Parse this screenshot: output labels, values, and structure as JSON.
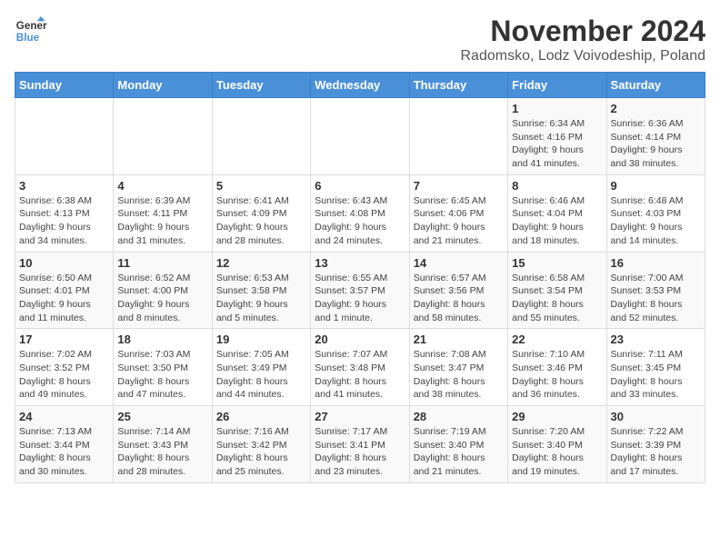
{
  "logo": {
    "line1": "General",
    "line2": "Blue"
  },
  "title": "November 2024",
  "subtitle": "Radomsko, Lodz Voivodeship, Poland",
  "weekdays": [
    "Sunday",
    "Monday",
    "Tuesday",
    "Wednesday",
    "Thursday",
    "Friday",
    "Saturday"
  ],
  "weeks": [
    [
      {
        "day": "",
        "info": ""
      },
      {
        "day": "",
        "info": ""
      },
      {
        "day": "",
        "info": ""
      },
      {
        "day": "",
        "info": ""
      },
      {
        "day": "",
        "info": ""
      },
      {
        "day": "1",
        "info": "Sunrise: 6:34 AM\nSunset: 4:16 PM\nDaylight: 9 hours\nand 41 minutes."
      },
      {
        "day": "2",
        "info": "Sunrise: 6:36 AM\nSunset: 4:14 PM\nDaylight: 9 hours\nand 38 minutes."
      }
    ],
    [
      {
        "day": "3",
        "info": "Sunrise: 6:38 AM\nSunset: 4:13 PM\nDaylight: 9 hours\nand 34 minutes."
      },
      {
        "day": "4",
        "info": "Sunrise: 6:39 AM\nSunset: 4:11 PM\nDaylight: 9 hours\nand 31 minutes."
      },
      {
        "day": "5",
        "info": "Sunrise: 6:41 AM\nSunset: 4:09 PM\nDaylight: 9 hours\nand 28 minutes."
      },
      {
        "day": "6",
        "info": "Sunrise: 6:43 AM\nSunset: 4:08 PM\nDaylight: 9 hours\nand 24 minutes."
      },
      {
        "day": "7",
        "info": "Sunrise: 6:45 AM\nSunset: 4:06 PM\nDaylight: 9 hours\nand 21 minutes."
      },
      {
        "day": "8",
        "info": "Sunrise: 6:46 AM\nSunset: 4:04 PM\nDaylight: 9 hours\nand 18 minutes."
      },
      {
        "day": "9",
        "info": "Sunrise: 6:48 AM\nSunset: 4:03 PM\nDaylight: 9 hours\nand 14 minutes."
      }
    ],
    [
      {
        "day": "10",
        "info": "Sunrise: 6:50 AM\nSunset: 4:01 PM\nDaylight: 9 hours\nand 11 minutes."
      },
      {
        "day": "11",
        "info": "Sunrise: 6:52 AM\nSunset: 4:00 PM\nDaylight: 9 hours\nand 8 minutes."
      },
      {
        "day": "12",
        "info": "Sunrise: 6:53 AM\nSunset: 3:58 PM\nDaylight: 9 hours\nand 5 minutes."
      },
      {
        "day": "13",
        "info": "Sunrise: 6:55 AM\nSunset: 3:57 PM\nDaylight: 9 hours\nand 1 minute."
      },
      {
        "day": "14",
        "info": "Sunrise: 6:57 AM\nSunset: 3:56 PM\nDaylight: 8 hours\nand 58 minutes."
      },
      {
        "day": "15",
        "info": "Sunrise: 6:58 AM\nSunset: 3:54 PM\nDaylight: 8 hours\nand 55 minutes."
      },
      {
        "day": "16",
        "info": "Sunrise: 7:00 AM\nSunset: 3:53 PM\nDaylight: 8 hours\nand 52 minutes."
      }
    ],
    [
      {
        "day": "17",
        "info": "Sunrise: 7:02 AM\nSunset: 3:52 PM\nDaylight: 8 hours\nand 49 minutes."
      },
      {
        "day": "18",
        "info": "Sunrise: 7:03 AM\nSunset: 3:50 PM\nDaylight: 8 hours\nand 47 minutes."
      },
      {
        "day": "19",
        "info": "Sunrise: 7:05 AM\nSunset: 3:49 PM\nDaylight: 8 hours\nand 44 minutes."
      },
      {
        "day": "20",
        "info": "Sunrise: 7:07 AM\nSunset: 3:48 PM\nDaylight: 8 hours\nand 41 minutes."
      },
      {
        "day": "21",
        "info": "Sunrise: 7:08 AM\nSunset: 3:47 PM\nDaylight: 8 hours\nand 38 minutes."
      },
      {
        "day": "22",
        "info": "Sunrise: 7:10 AM\nSunset: 3:46 PM\nDaylight: 8 hours\nand 36 minutes."
      },
      {
        "day": "23",
        "info": "Sunrise: 7:11 AM\nSunset: 3:45 PM\nDaylight: 8 hours\nand 33 minutes."
      }
    ],
    [
      {
        "day": "24",
        "info": "Sunrise: 7:13 AM\nSunset: 3:44 PM\nDaylight: 8 hours\nand 30 minutes."
      },
      {
        "day": "25",
        "info": "Sunrise: 7:14 AM\nSunset: 3:43 PM\nDaylight: 8 hours\nand 28 minutes."
      },
      {
        "day": "26",
        "info": "Sunrise: 7:16 AM\nSunset: 3:42 PM\nDaylight: 8 hours\nand 25 minutes."
      },
      {
        "day": "27",
        "info": "Sunrise: 7:17 AM\nSunset: 3:41 PM\nDaylight: 8 hours\nand 23 minutes."
      },
      {
        "day": "28",
        "info": "Sunrise: 7:19 AM\nSunset: 3:40 PM\nDaylight: 8 hours\nand 21 minutes."
      },
      {
        "day": "29",
        "info": "Sunrise: 7:20 AM\nSunset: 3:40 PM\nDaylight: 8 hours\nand 19 minutes."
      },
      {
        "day": "30",
        "info": "Sunrise: 7:22 AM\nSunset: 3:39 PM\nDaylight: 8 hours\nand 17 minutes."
      }
    ]
  ]
}
